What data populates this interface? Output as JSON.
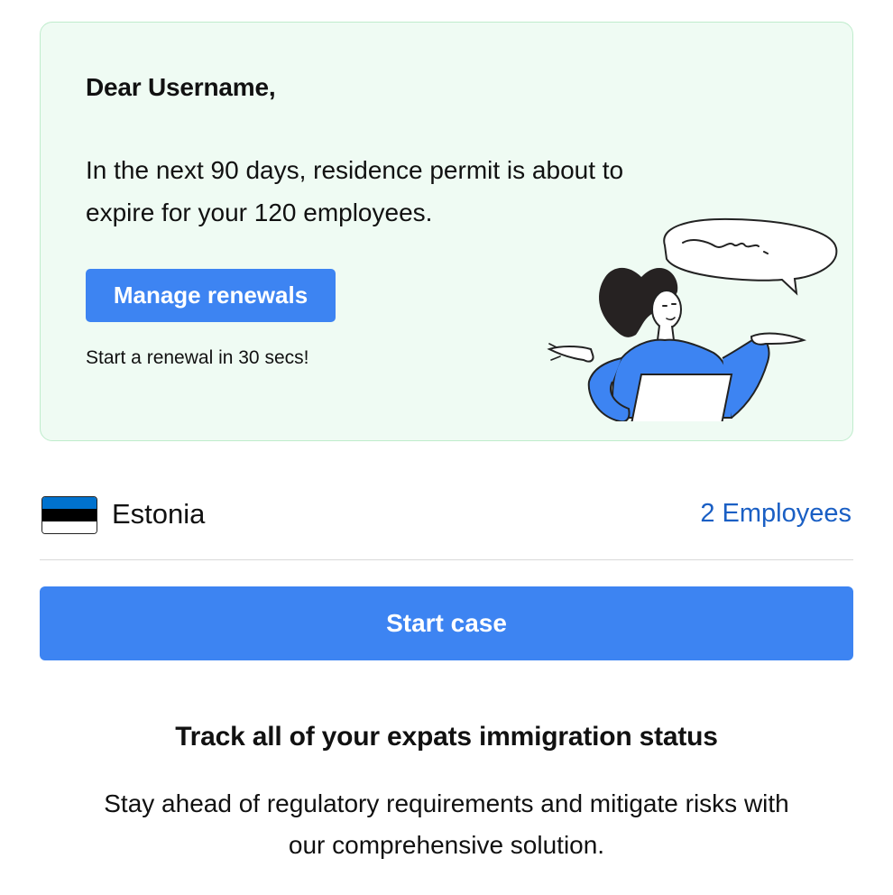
{
  "banner": {
    "greeting": "Dear Username,",
    "message": "In the next 90 days, residence permit is about to expire for your 120 employees.",
    "manage_button": "Manage renewals",
    "note": "Start a renewal in 30 secs!",
    "illustration_icon": "person-shrugging-laptop-illustration"
  },
  "country": {
    "flag_icon": "estonia-flag-icon",
    "name": "Estonia",
    "employees_link": "2 Employees"
  },
  "actions": {
    "start_case": "Start case"
  },
  "info": {
    "title": "Track all of your expats immigration status",
    "description": "Stay ahead of regulatory requirements and mitigate risks with our comprehensive solution."
  },
  "colors": {
    "accent": "#3d84f2",
    "link": "#1a5fc4",
    "banner_bg": "#effbf3",
    "banner_border": "#bfeccc"
  }
}
